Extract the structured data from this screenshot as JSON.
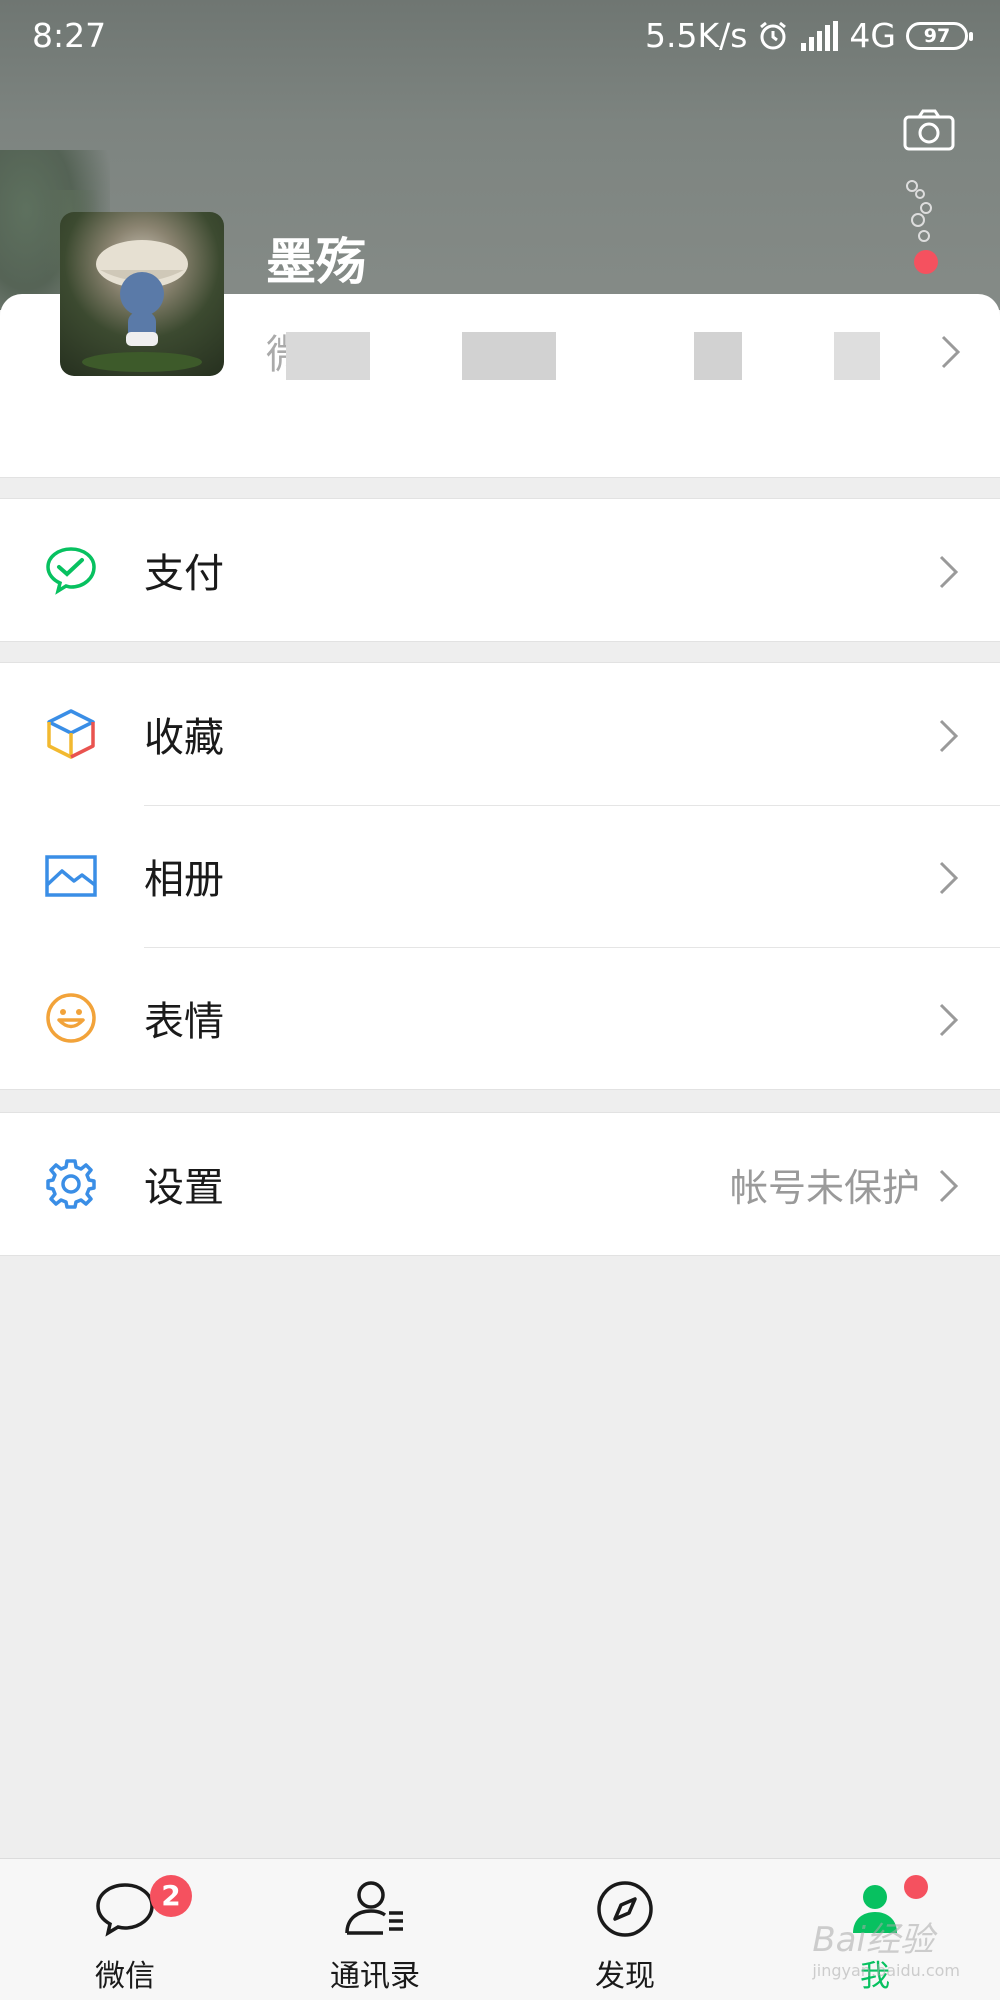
{
  "status_bar": {
    "time": "8:27",
    "network_speed": "5.5K/s",
    "network_type": "4G",
    "battery": "97"
  },
  "profile": {
    "nickname": "墨殇",
    "wechat_id_prefix": "微"
  },
  "menu": {
    "pay": {
      "label": "支付",
      "icon": "wechat-pay-icon"
    },
    "favorites": {
      "label": "收藏",
      "icon": "cube-icon"
    },
    "album": {
      "label": "相册",
      "icon": "image-icon"
    },
    "stickers": {
      "label": "表情",
      "icon": "smiley-icon"
    },
    "settings": {
      "label": "设置",
      "value": "帐号未保护",
      "icon": "gear-icon"
    }
  },
  "tabbar": {
    "tabs": [
      {
        "label": "微信",
        "badge": "2",
        "icon": "chat-bubble-icon"
      },
      {
        "label": "通讯录",
        "icon": "contacts-icon"
      },
      {
        "label": "发现",
        "icon": "compass-icon"
      },
      {
        "label": "我",
        "icon": "me-icon",
        "active": true
      }
    ]
  },
  "watermark": {
    "text": "Bai经验",
    "sub": "jingyan.baidu.com"
  },
  "colors": {
    "accent": "#07c160",
    "badge": "#f5515f",
    "background": "#eeeeee"
  }
}
